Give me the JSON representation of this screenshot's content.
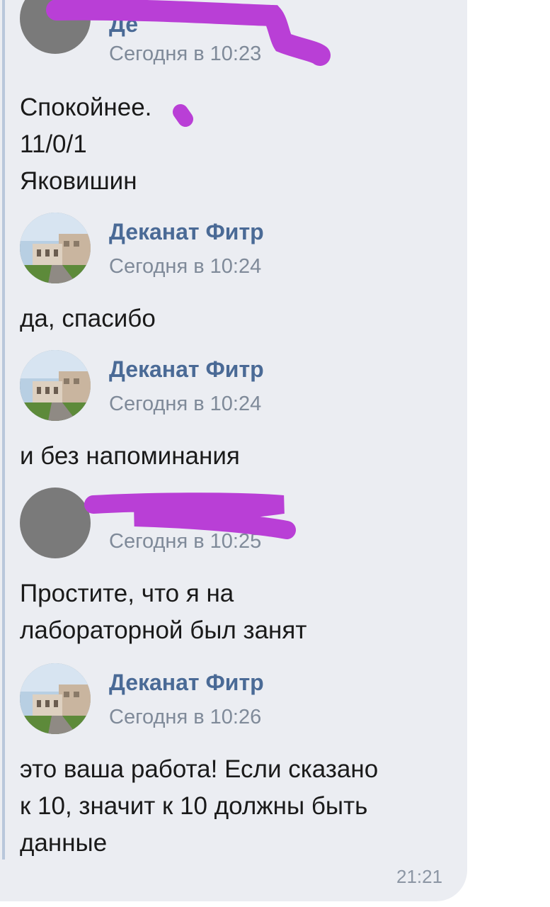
{
  "messages": [
    {
      "author": "Де",
      "time": "Сегодня в 10:23",
      "avatar": "gray-placeholder",
      "lines": [
        "Спокойнее.",
        "11/0/1",
        "Яковишин"
      ]
    },
    {
      "author": "Деканат Фитр",
      "time": "Сегодня в 10:24",
      "avatar": "building-photo",
      "lines": [
        "да, спасибо"
      ]
    },
    {
      "author": "Деканат Фитр",
      "time": "Сегодня в 10:24",
      "avatar": "building-photo",
      "lines": [
        "и без напоминания"
      ]
    },
    {
      "author": "",
      "time": "Сегодня в 10:25",
      "avatar": "gray-placeholder",
      "lines": [
        "Простите, что я на",
        "лабораторной был занят"
      ]
    },
    {
      "author": "Деканат Фитр",
      "time": "Сегодня в 10:26",
      "avatar": "building-photo",
      "lines": [
        "это ваша работа! Если сказано",
        "к 10, значит к 10 должны быть",
        "данные"
      ]
    }
  ],
  "bubble_time": "21:21",
  "colors": {
    "bubble": "#ebedf2",
    "author": "#4a6a96",
    "muted": "#7f8a99",
    "redaction": "#b93fd6"
  }
}
